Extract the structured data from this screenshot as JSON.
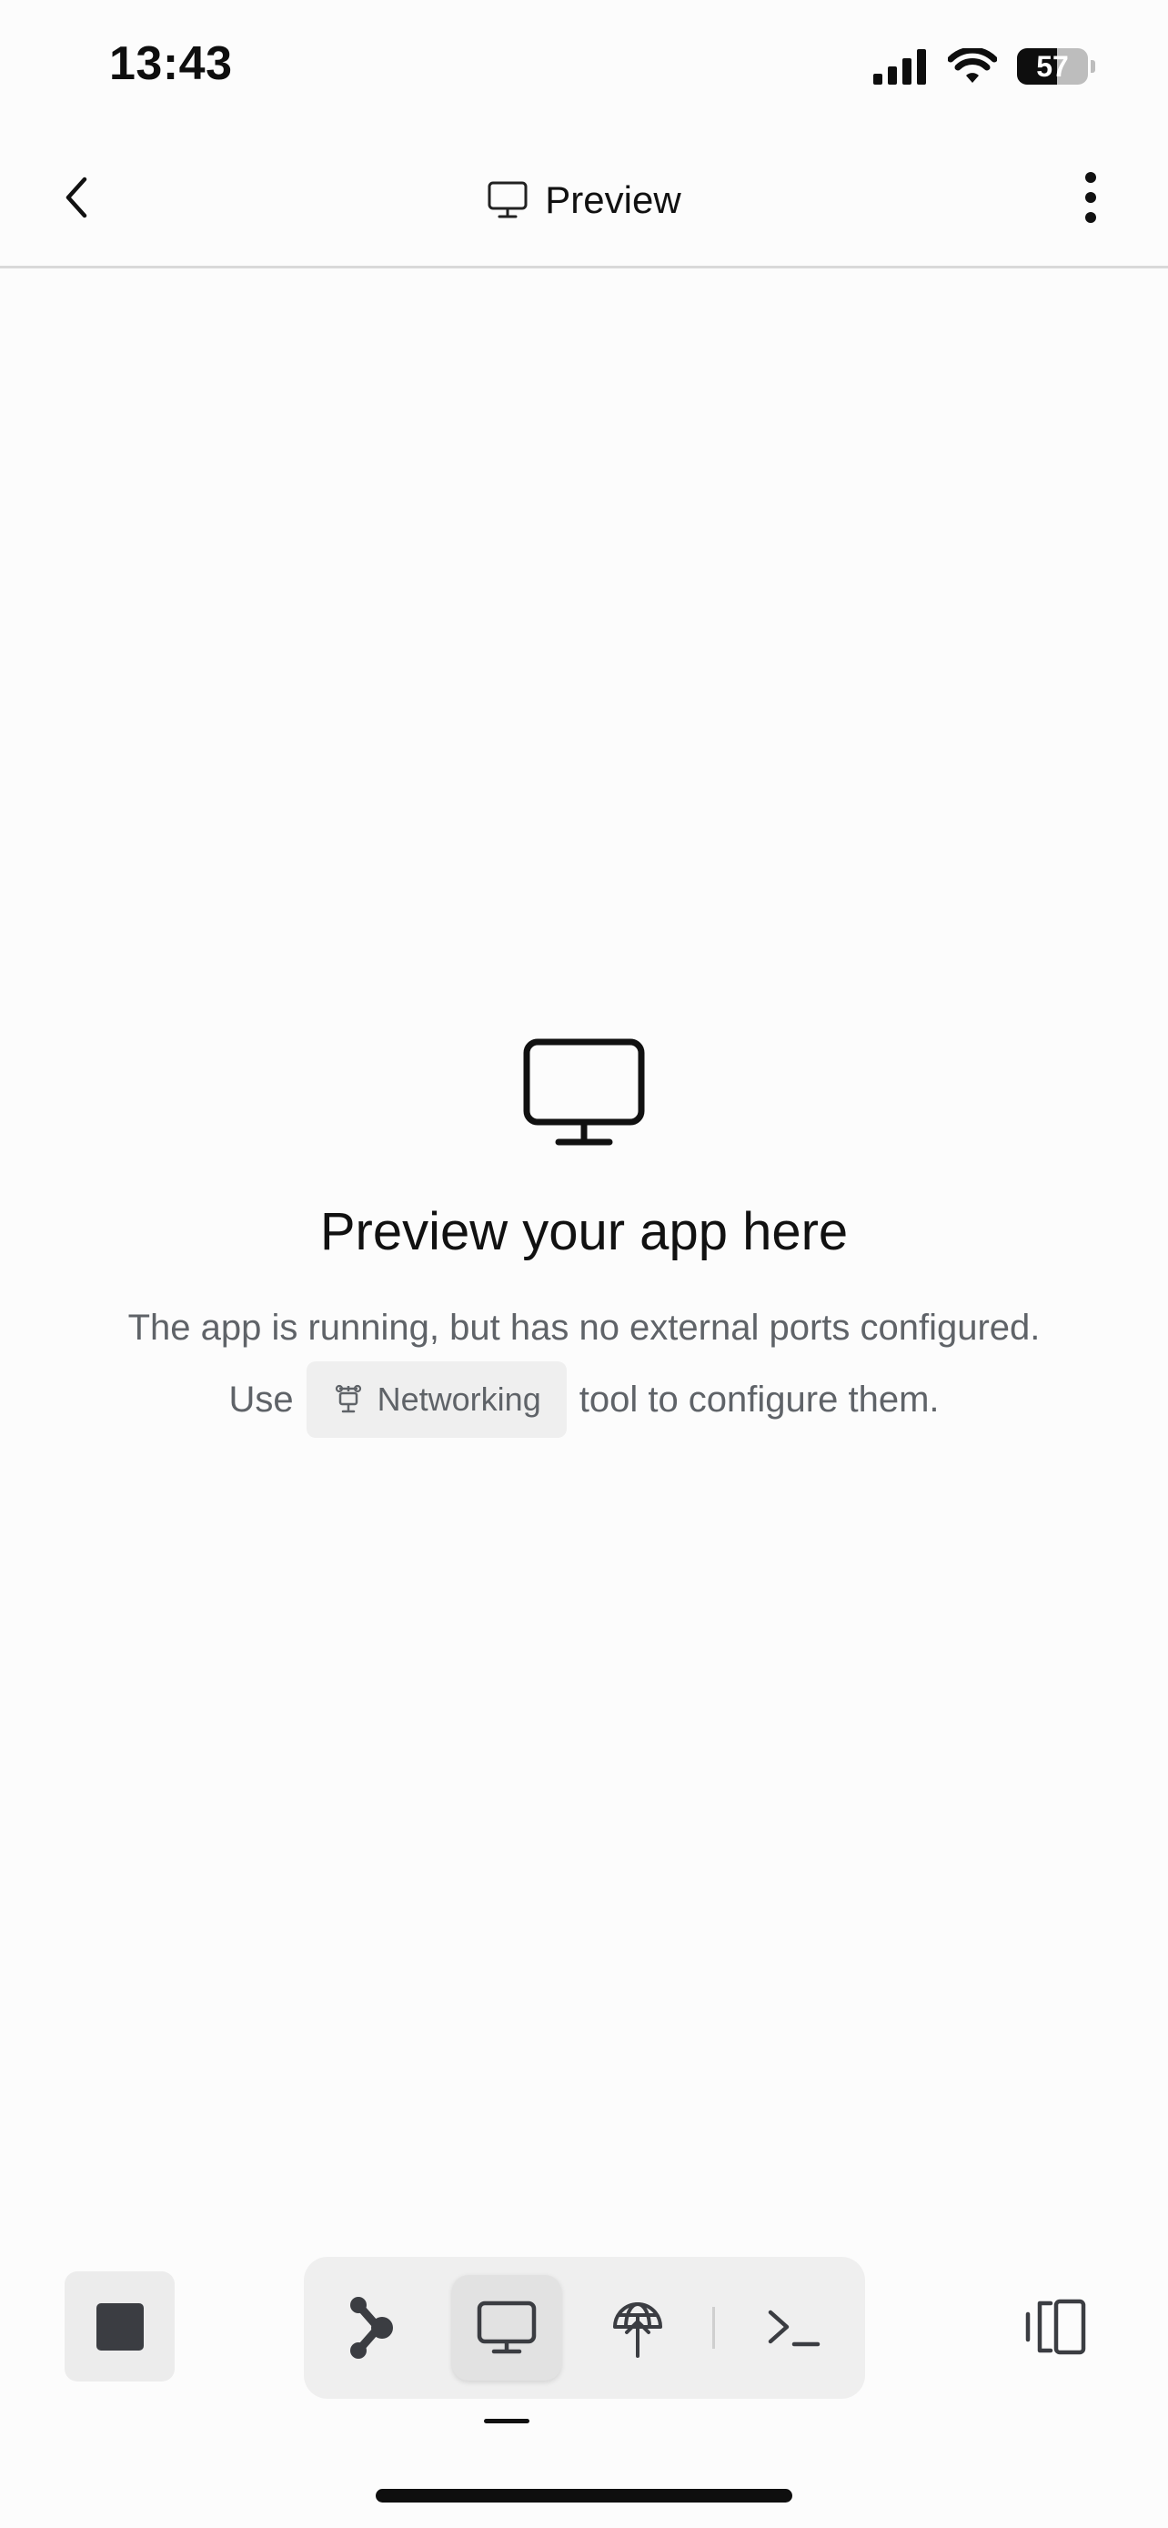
{
  "status_bar": {
    "time": "13:43",
    "battery": "57",
    "icons": [
      "cellular-signal-icon",
      "wifi-icon",
      "battery-icon"
    ]
  },
  "nav": {
    "title": "Preview",
    "back_icon": "chevron-left-icon",
    "title_icon": "monitor-icon",
    "more_icon": "more-vertical-icon"
  },
  "empty_state": {
    "icon": "monitor-icon",
    "title": "Preview your app here",
    "line1": "The app is running, but has no external ports configured.",
    "line2_prefix": "Use",
    "chip_label": "Networking",
    "chip_icon": "networking-icon",
    "line2_suffix": "tool to configure them."
  },
  "bottom_toolbar": {
    "stop_icon": "stop-icon",
    "tools": [
      {
        "name": "agent-tool",
        "icon": "agent-icon",
        "active": false
      },
      {
        "name": "preview-tool",
        "icon": "monitor-icon",
        "active": true
      },
      {
        "name": "deploy-tool",
        "icon": "globe-upload-icon",
        "active": false
      },
      {
        "name": "shell-tool",
        "icon": "terminal-icon",
        "active": false
      }
    ],
    "layout_icon": "split-view-icon"
  },
  "colors": {
    "background": "#fcfcfc",
    "text_primary": "#111111",
    "text_secondary": "#5f6368",
    "chip_bg": "#efefef",
    "stop": "#3b3d42"
  }
}
